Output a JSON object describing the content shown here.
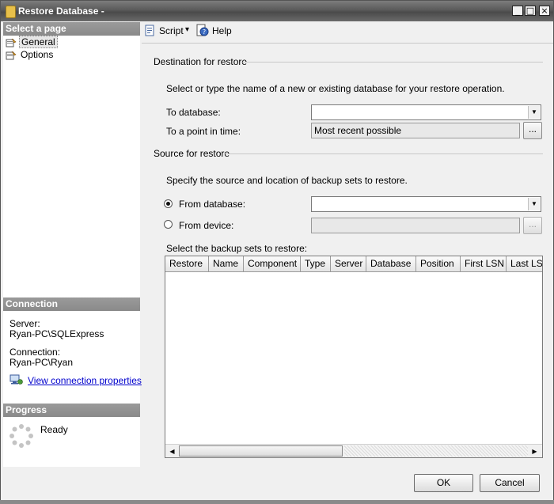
{
  "window": {
    "title": "Restore Database -",
    "minimize": "_",
    "maximize": "□",
    "close": "×"
  },
  "left": {
    "select_page_header": "Select a page",
    "pages": [
      {
        "label": "General",
        "selected": true
      },
      {
        "label": "Options",
        "selected": false
      }
    ],
    "connection_header": "Connection",
    "server_label": "Server:",
    "server_value": "Ryan-PC\\SQLExpress",
    "connection_label": "Connection:",
    "connection_value": "Ryan-PC\\Ryan",
    "view_connection_link": "View connection properties",
    "progress_header": "Progress",
    "progress_status": "Ready"
  },
  "toolbar": {
    "script_label": "Script",
    "script_dropdown": "▾",
    "help_label": "Help"
  },
  "destination": {
    "group_title": "Destination for restore",
    "instruction": "Select or type the name of a new or existing database for your restore operation.",
    "to_database_label": "To database:",
    "to_database_value": "",
    "point_in_time_label": "To a point in time:",
    "point_in_time_value": "Most recent possible",
    "ellipsis": "..."
  },
  "source": {
    "group_title": "Source for restore",
    "instruction": "Specify the source and location of backup sets to restore.",
    "from_database_label": "From database:",
    "from_database_selected": true,
    "from_database_value": "",
    "from_device_label": "From device:",
    "from_device_value": "",
    "ellipsis": "...",
    "backup_sets_label": "Select the backup sets to restore:"
  },
  "grid": {
    "columns": [
      "Restore",
      "Name",
      "Component",
      "Type",
      "Server",
      "Database",
      "Position",
      "First LSN",
      "Last LSN"
    ],
    "scroll_left": "◀",
    "scroll_right": "▶"
  },
  "buttons": {
    "ok": "OK",
    "cancel": "Cancel"
  },
  "colors": {
    "title_bar": "#5a5a5a",
    "section_header": "#8f8f8f",
    "link": "#0000cc",
    "background": "#f0f0f0"
  },
  "icons": [
    "app-database-icon",
    "page-general-icon",
    "page-options-icon",
    "script-icon",
    "help-icon",
    "connection-properties-icon",
    "progress-spinner-icon"
  ]
}
